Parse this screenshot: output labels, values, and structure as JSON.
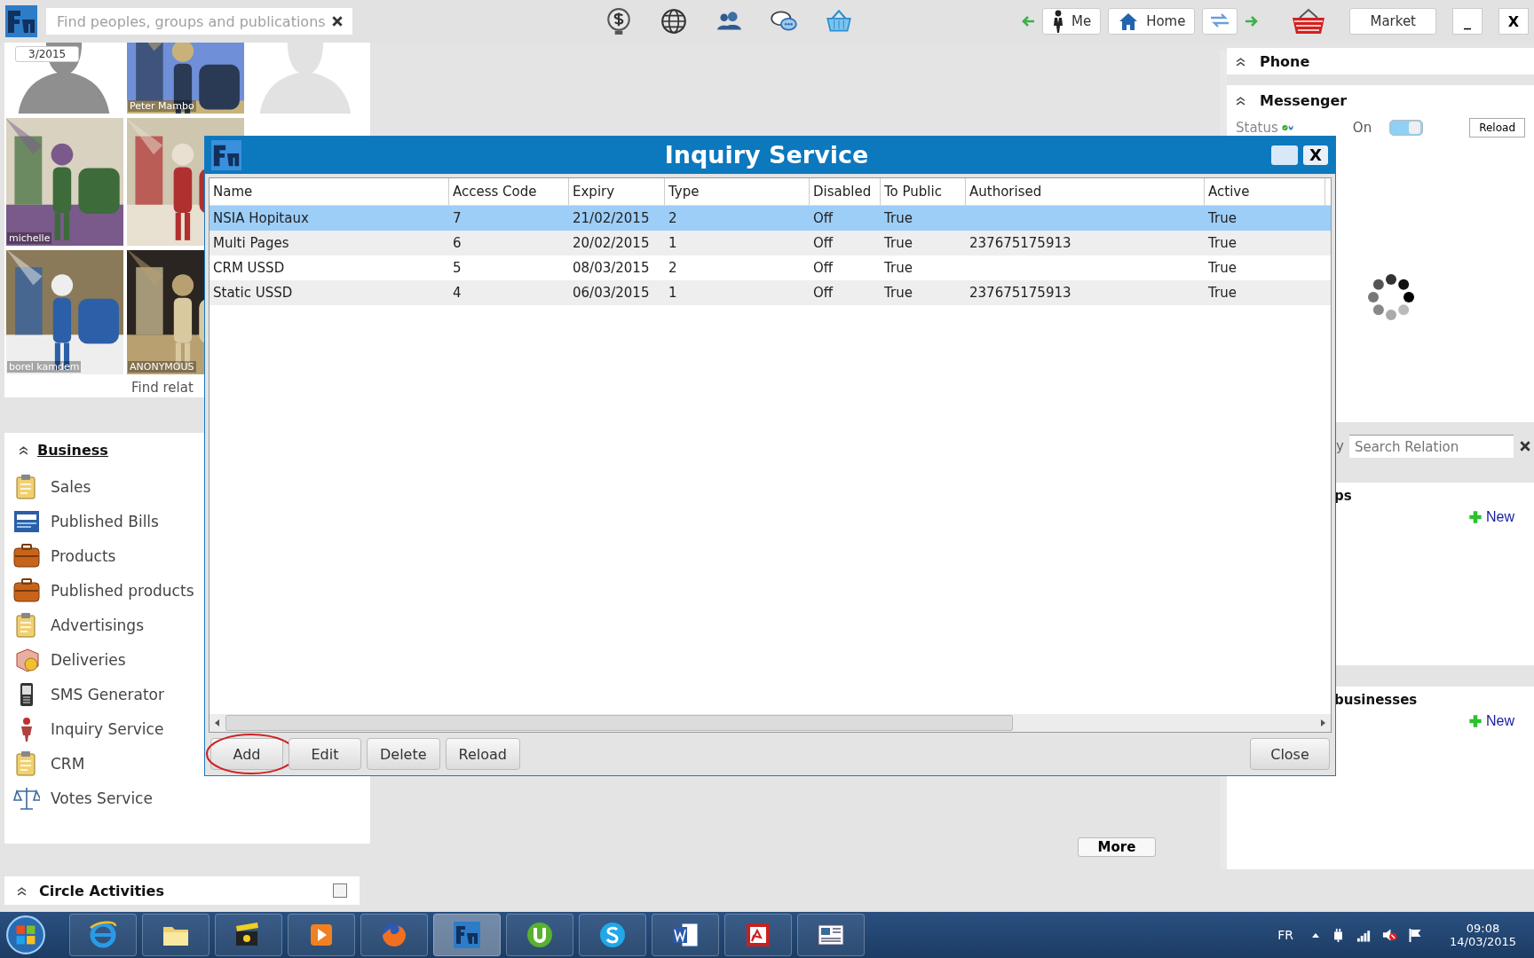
{
  "topbar": {
    "search": {
      "placeholder": "Find peoples, groups and publications"
    },
    "nav_buttons": [
      {
        "label": "Me",
        "kind": "me"
      },
      {
        "label": "Home",
        "kind": "home"
      }
    ],
    "market_button": "Market",
    "window_controls": [
      "_",
      "X"
    ]
  },
  "contacts": [
    {
      "kind": "silhouette",
      "badge": "3/2015"
    },
    {
      "kind": "picture",
      "caption": "Peter Mambo"
    },
    {
      "kind": "silhouette"
    },
    {
      "kind": "picture",
      "caption": "michelle"
    },
    {
      "kind": "picture"
    },
    {
      "kind": "picture",
      "caption": "borel kamdem"
    },
    {
      "kind": "picture",
      "caption": "ANONYMOUS"
    }
  ],
  "find_relations_link": "Find relat",
  "business": {
    "title": "Business",
    "items": [
      {
        "label": "Sales",
        "kind": "clipboard"
      },
      {
        "label": "Published Bills",
        "kind": "bills"
      },
      {
        "label": "Products",
        "kind": "case"
      },
      {
        "label": "Published products",
        "kind": "case"
      },
      {
        "label": "Advertisings",
        "kind": "clipboard"
      },
      {
        "label": "Deliveries",
        "kind": "parcel"
      },
      {
        "label": "SMS Generator",
        "kind": "phone"
      },
      {
        "label": "Inquiry Service",
        "kind": "person"
      },
      {
        "label": "CRM",
        "kind": "clipboard"
      },
      {
        "label": "Votes Service",
        "kind": "scales"
      }
    ]
  },
  "circle_activities": {
    "title": "Circle Activities",
    "checked": false
  },
  "more_button": "More",
  "right_panel": {
    "phone": {
      "title": "Phone"
    },
    "messenger": {
      "title": "Messenger",
      "status_label": "Status",
      "toggle_label": "On",
      "on": true,
      "reload_button": "Reload"
    },
    "search": {
      "prefix": "y",
      "placeholder": "Search Relation"
    },
    "groups": {
      "title": "ps",
      "new_link": "New"
    },
    "businesses": {
      "title": "businesses",
      "new_link": "New"
    }
  },
  "dialog": {
    "title": "Inquiry Service",
    "columns": [
      "Name",
      "Access Code",
      "Expiry",
      "Type",
      "Disabled",
      "To Public",
      "Authorised",
      "Active"
    ],
    "rows": [
      {
        "cells": [
          "NSIA Hopitaux",
          "7",
          "21/02/2015",
          "2",
          "Off",
          "True",
          "",
          "True"
        ],
        "selected": true
      },
      {
        "cells": [
          "Multi Pages",
          "6",
          "20/02/2015",
          "1",
          "Off",
          "True",
          "237675175913",
          "True"
        ],
        "selected": false
      },
      {
        "cells": [
          "CRM USSD",
          "5",
          "08/03/2015",
          "2",
          "Off",
          "True",
          "",
          "True"
        ],
        "selected": false
      },
      {
        "cells": [
          "Static USSD",
          "4",
          "06/03/2015",
          "1",
          "Off",
          "True",
          "237675175913",
          "True"
        ],
        "selected": false
      }
    ],
    "buttons": [
      {
        "label": "Add",
        "circled": true
      },
      {
        "label": "Edit",
        "circled": false
      },
      {
        "label": "Delete",
        "circled": false
      },
      {
        "label": "Reload",
        "circled": false
      }
    ],
    "close_button": "Close",
    "close_control": "X"
  },
  "taskbar": {
    "apps": [
      {
        "kind": "ie",
        "selected": false
      },
      {
        "kind": "folder",
        "selected": false
      },
      {
        "kind": "clapper",
        "selected": false
      },
      {
        "kind": "player",
        "selected": false
      },
      {
        "kind": "firefox",
        "selected": false
      },
      {
        "kind": "fm",
        "selected": true
      },
      {
        "kind": "torrent",
        "selected": false
      },
      {
        "kind": "skype",
        "selected": false
      },
      {
        "kind": "word",
        "selected": false
      },
      {
        "kind": "pdf",
        "selected": false
      },
      {
        "kind": "news",
        "selected": false
      }
    ],
    "language": "FR",
    "time": "09:08",
    "date": "14/03/2015"
  }
}
